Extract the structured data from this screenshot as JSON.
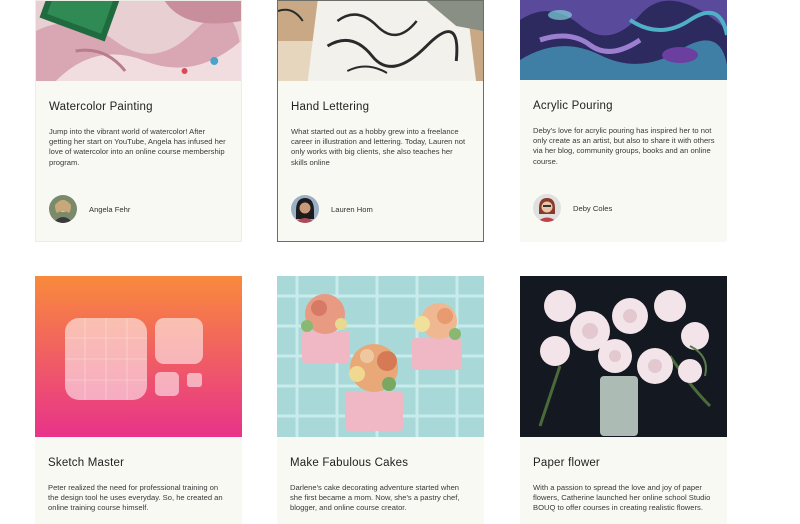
{
  "cards": [
    {
      "title": "Watercolor Painting",
      "description": "Jump into the vibrant world of watercolor! After getting her start on YouTube, Angela has infused her love of watercolor into an online course membership program.",
      "author": "Angela Fehr",
      "image": "watercolor-photo"
    },
    {
      "title": "Hand Lettering",
      "description": "What started out as a hobby grew into a freelance career in illustration and lettering. Today, Lauren not only works with big clients, she also teaches her skills online",
      "author": "Lauren Hom",
      "image": "hand-lettering-photo"
    },
    {
      "title": "Acrylic Pouring",
      "description": "Deby's love for acrylic pouring has inspired her to not only create as an artist, but also to share it with others via her blog, community groups, books and an online course.",
      "author": "Deby Coles",
      "image": "acrylic-pour-photo"
    },
    {
      "title": "Sketch Master",
      "description": "Peter realized the need for professional training on the design tool he uses everyday. So, he created an online training course himself.",
      "image": "sketch-app-icon"
    },
    {
      "title": "Make Fabulous Cakes",
      "description": "Darlene's cake decorating adventure started when she first became a mom. Now, she's a pastry chef, blogger, and online course creator.",
      "image": "cupcakes-photo"
    },
    {
      "title": "Paper flower",
      "description": "With a passion to spread the love and joy of paper flowers, Catherine launched her online school Studio BOUQ to offer courses in creating realistic flowers.",
      "image": "paper-flowers-photo"
    }
  ]
}
